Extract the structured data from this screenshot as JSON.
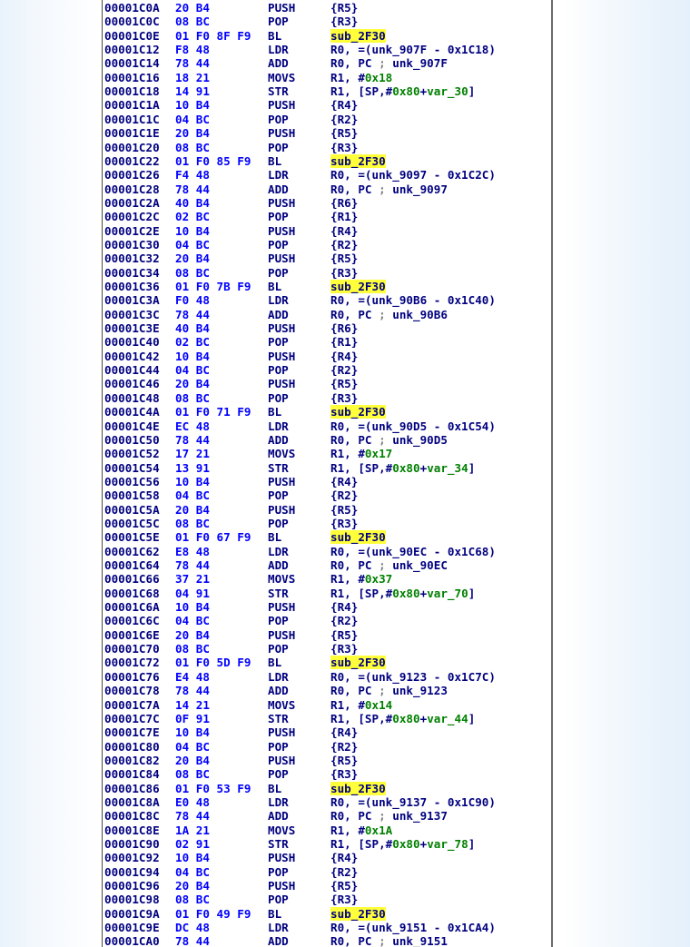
{
  "listing": [
    {
      "addr": "00001C0A",
      "bytes": "20 B4",
      "mnem": "PUSH",
      "ops": [
        {
          "t": "{R5}"
        }
      ]
    },
    {
      "addr": "00001C0C",
      "bytes": "08 BC",
      "mnem": "POP",
      "ops": [
        {
          "t": "{R3}"
        }
      ]
    },
    {
      "addr": "00001C0E",
      "bytes": "01 F0 8F F9",
      "mnem": "BL",
      "ops": [
        {
          "t": "sub_2F30",
          "c": "hl"
        }
      ]
    },
    {
      "addr": "00001C12",
      "bytes": "F8 48",
      "mnem": "LDR",
      "ops": [
        {
          "t": "R0, =(unk_907F - 0x1C18)"
        }
      ]
    },
    {
      "addr": "00001C14",
      "bytes": "78 44",
      "mnem": "ADD",
      "ops": [
        {
          "t": "R0, PC "
        },
        {
          "t": ";",
          "c": "cmt"
        },
        {
          "t": " unk_907F"
        }
      ]
    },
    {
      "addr": "00001C16",
      "bytes": "18 21",
      "mnem": "MOVS",
      "ops": [
        {
          "t": "R1, #"
        },
        {
          "t": "0x18",
          "c": "num"
        }
      ]
    },
    {
      "addr": "00001C18",
      "bytes": "14 91",
      "mnem": "STR",
      "ops": [
        {
          "t": "R1, [SP,#"
        },
        {
          "t": "0x80",
          "c": "num"
        },
        {
          "t": "+"
        },
        {
          "t": "var_30",
          "c": "var"
        },
        {
          "t": "]"
        }
      ]
    },
    {
      "addr": "00001C1A",
      "bytes": "10 B4",
      "mnem": "PUSH",
      "ops": [
        {
          "t": "{R4}"
        }
      ]
    },
    {
      "addr": "00001C1C",
      "bytes": "04 BC",
      "mnem": "POP",
      "ops": [
        {
          "t": "{R2}"
        }
      ]
    },
    {
      "addr": "00001C1E",
      "bytes": "20 B4",
      "mnem": "PUSH",
      "ops": [
        {
          "t": "{R5}"
        }
      ]
    },
    {
      "addr": "00001C20",
      "bytes": "08 BC",
      "mnem": "POP",
      "ops": [
        {
          "t": "{R3}"
        }
      ]
    },
    {
      "addr": "00001C22",
      "bytes": "01 F0 85 F9",
      "mnem": "BL",
      "ops": [
        {
          "t": "sub_2F30",
          "c": "hl"
        }
      ]
    },
    {
      "addr": "00001C26",
      "bytes": "F4 48",
      "mnem": "LDR",
      "ops": [
        {
          "t": "R0, =(unk_9097 - 0x1C2C)"
        }
      ]
    },
    {
      "addr": "00001C28",
      "bytes": "78 44",
      "mnem": "ADD",
      "ops": [
        {
          "t": "R0, PC "
        },
        {
          "t": ";",
          "c": "cmt"
        },
        {
          "t": " unk_9097"
        }
      ]
    },
    {
      "addr": "00001C2A",
      "bytes": "40 B4",
      "mnem": "PUSH",
      "ops": [
        {
          "t": "{R6}"
        }
      ]
    },
    {
      "addr": "00001C2C",
      "bytes": "02 BC",
      "mnem": "POP",
      "ops": [
        {
          "t": "{R1}"
        }
      ]
    },
    {
      "addr": "00001C2E",
      "bytes": "10 B4",
      "mnem": "PUSH",
      "ops": [
        {
          "t": "{R4}"
        }
      ]
    },
    {
      "addr": "00001C30",
      "bytes": "04 BC",
      "mnem": "POP",
      "ops": [
        {
          "t": "{R2}"
        }
      ]
    },
    {
      "addr": "00001C32",
      "bytes": "20 B4",
      "mnem": "PUSH",
      "ops": [
        {
          "t": "{R5}"
        }
      ]
    },
    {
      "addr": "00001C34",
      "bytes": "08 BC",
      "mnem": "POP",
      "ops": [
        {
          "t": "{R3}"
        }
      ]
    },
    {
      "addr": "00001C36",
      "bytes": "01 F0 7B F9",
      "mnem": "BL",
      "ops": [
        {
          "t": "sub_2F30",
          "c": "hl"
        }
      ]
    },
    {
      "addr": "00001C3A",
      "bytes": "F0 48",
      "mnem": "LDR",
      "ops": [
        {
          "t": "R0, =(unk_90B6 - 0x1C40)"
        }
      ]
    },
    {
      "addr": "00001C3C",
      "bytes": "78 44",
      "mnem": "ADD",
      "ops": [
        {
          "t": "R0, PC "
        },
        {
          "t": ";",
          "c": "cmt"
        },
        {
          "t": " unk_90B6"
        }
      ]
    },
    {
      "addr": "00001C3E",
      "bytes": "40 B4",
      "mnem": "PUSH",
      "ops": [
        {
          "t": "{R6}"
        }
      ]
    },
    {
      "addr": "00001C40",
      "bytes": "02 BC",
      "mnem": "POP",
      "ops": [
        {
          "t": "{R1}"
        }
      ]
    },
    {
      "addr": "00001C42",
      "bytes": "10 B4",
      "mnem": "PUSH",
      "ops": [
        {
          "t": "{R4}"
        }
      ]
    },
    {
      "addr": "00001C44",
      "bytes": "04 BC",
      "mnem": "POP",
      "ops": [
        {
          "t": "{R2}"
        }
      ]
    },
    {
      "addr": "00001C46",
      "bytes": "20 B4",
      "mnem": "PUSH",
      "ops": [
        {
          "t": "{R5}"
        }
      ]
    },
    {
      "addr": "00001C48",
      "bytes": "08 BC",
      "mnem": "POP",
      "ops": [
        {
          "t": "{R3}"
        }
      ]
    },
    {
      "addr": "00001C4A",
      "bytes": "01 F0 71 F9",
      "mnem": "BL",
      "ops": [
        {
          "t": "sub_2F30",
          "c": "hl"
        }
      ]
    },
    {
      "addr": "00001C4E",
      "bytes": "EC 48",
      "mnem": "LDR",
      "ops": [
        {
          "t": "R0, =(unk_90D5 - 0x1C54)"
        }
      ]
    },
    {
      "addr": "00001C50",
      "bytes": "78 44",
      "mnem": "ADD",
      "ops": [
        {
          "t": "R0, PC "
        },
        {
          "t": ";",
          "c": "cmt"
        },
        {
          "t": " unk_90D5"
        }
      ]
    },
    {
      "addr": "00001C52",
      "bytes": "17 21",
      "mnem": "MOVS",
      "ops": [
        {
          "t": "R1, #"
        },
        {
          "t": "0x17",
          "c": "num"
        }
      ]
    },
    {
      "addr": "00001C54",
      "bytes": "13 91",
      "mnem": "STR",
      "ops": [
        {
          "t": "R1, [SP,#"
        },
        {
          "t": "0x80",
          "c": "num"
        },
        {
          "t": "+"
        },
        {
          "t": "var_34",
          "c": "var"
        },
        {
          "t": "]"
        }
      ]
    },
    {
      "addr": "00001C56",
      "bytes": "10 B4",
      "mnem": "PUSH",
      "ops": [
        {
          "t": "{R4}"
        }
      ]
    },
    {
      "addr": "00001C58",
      "bytes": "04 BC",
      "mnem": "POP",
      "ops": [
        {
          "t": "{R2}"
        }
      ]
    },
    {
      "addr": "00001C5A",
      "bytes": "20 B4",
      "mnem": "PUSH",
      "ops": [
        {
          "t": "{R5}"
        }
      ]
    },
    {
      "addr": "00001C5C",
      "bytes": "08 BC",
      "mnem": "POP",
      "ops": [
        {
          "t": "{R3}"
        }
      ]
    },
    {
      "addr": "00001C5E",
      "bytes": "01 F0 67 F9",
      "mnem": "BL",
      "ops": [
        {
          "t": "sub_2F30",
          "c": "hl"
        }
      ]
    },
    {
      "addr": "00001C62",
      "bytes": "E8 48",
      "mnem": "LDR",
      "ops": [
        {
          "t": "R0, =(unk_90EC - 0x1C68)"
        }
      ]
    },
    {
      "addr": "00001C64",
      "bytes": "78 44",
      "mnem": "ADD",
      "ops": [
        {
          "t": "R0, PC "
        },
        {
          "t": ";",
          "c": "cmt"
        },
        {
          "t": " unk_90EC"
        }
      ]
    },
    {
      "addr": "00001C66",
      "bytes": "37 21",
      "mnem": "MOVS",
      "ops": [
        {
          "t": "R1, #"
        },
        {
          "t": "0x37",
          "c": "num"
        }
      ]
    },
    {
      "addr": "00001C68",
      "bytes": "04 91",
      "mnem": "STR",
      "ops": [
        {
          "t": "R1, [SP,#"
        },
        {
          "t": "0x80",
          "c": "num"
        },
        {
          "t": "+"
        },
        {
          "t": "var_70",
          "c": "var"
        },
        {
          "t": "]"
        }
      ]
    },
    {
      "addr": "00001C6A",
      "bytes": "10 B4",
      "mnem": "PUSH",
      "ops": [
        {
          "t": "{R4}"
        }
      ]
    },
    {
      "addr": "00001C6C",
      "bytes": "04 BC",
      "mnem": "POP",
      "ops": [
        {
          "t": "{R2}"
        }
      ]
    },
    {
      "addr": "00001C6E",
      "bytes": "20 B4",
      "mnem": "PUSH",
      "ops": [
        {
          "t": "{R5}"
        }
      ]
    },
    {
      "addr": "00001C70",
      "bytes": "08 BC",
      "mnem": "POP",
      "ops": [
        {
          "t": "{R3}"
        }
      ]
    },
    {
      "addr": "00001C72",
      "bytes": "01 F0 5D F9",
      "mnem": "BL",
      "ops": [
        {
          "t": "sub_2F30",
          "c": "hl"
        }
      ]
    },
    {
      "addr": "00001C76",
      "bytes": "E4 48",
      "mnem": "LDR",
      "ops": [
        {
          "t": "R0, =(unk_9123 - 0x1C7C)"
        }
      ]
    },
    {
      "addr": "00001C78",
      "bytes": "78 44",
      "mnem": "ADD",
      "ops": [
        {
          "t": "R0, PC "
        },
        {
          "t": ";",
          "c": "cmt"
        },
        {
          "t": " unk_9123"
        }
      ]
    },
    {
      "addr": "00001C7A",
      "bytes": "14 21",
      "mnem": "MOVS",
      "ops": [
        {
          "t": "R1, #"
        },
        {
          "t": "0x14",
          "c": "num"
        }
      ]
    },
    {
      "addr": "00001C7C",
      "bytes": "0F 91",
      "mnem": "STR",
      "ops": [
        {
          "t": "R1, [SP,#"
        },
        {
          "t": "0x80",
          "c": "num"
        },
        {
          "t": "+"
        },
        {
          "t": "var_44",
          "c": "var"
        },
        {
          "t": "]"
        }
      ]
    },
    {
      "addr": "00001C7E",
      "bytes": "10 B4",
      "mnem": "PUSH",
      "ops": [
        {
          "t": "{R4}"
        }
      ]
    },
    {
      "addr": "00001C80",
      "bytes": "04 BC",
      "mnem": "POP",
      "ops": [
        {
          "t": "{R2}"
        }
      ]
    },
    {
      "addr": "00001C82",
      "bytes": "20 B4",
      "mnem": "PUSH",
      "ops": [
        {
          "t": "{R5}"
        }
      ]
    },
    {
      "addr": "00001C84",
      "bytes": "08 BC",
      "mnem": "POP",
      "ops": [
        {
          "t": "{R3}"
        }
      ]
    },
    {
      "addr": "00001C86",
      "bytes": "01 F0 53 F9",
      "mnem": "BL",
      "ops": [
        {
          "t": "sub_2F30",
          "c": "hl"
        }
      ]
    },
    {
      "addr": "00001C8A",
      "bytes": "E0 48",
      "mnem": "LDR",
      "ops": [
        {
          "t": "R0, =(unk_9137 - 0x1C90)"
        }
      ]
    },
    {
      "addr": "00001C8C",
      "bytes": "78 44",
      "mnem": "ADD",
      "ops": [
        {
          "t": "R0, PC "
        },
        {
          "t": ";",
          "c": "cmt"
        },
        {
          "t": " unk_9137"
        }
      ]
    },
    {
      "addr": "00001C8E",
      "bytes": "1A 21",
      "mnem": "MOVS",
      "ops": [
        {
          "t": "R1, #"
        },
        {
          "t": "0x1A",
          "c": "num"
        }
      ]
    },
    {
      "addr": "00001C90",
      "bytes": "02 91",
      "mnem": "STR",
      "ops": [
        {
          "t": "R1, [SP,#"
        },
        {
          "t": "0x80",
          "c": "num"
        },
        {
          "t": "+"
        },
        {
          "t": "var_78",
          "c": "var"
        },
        {
          "t": "]"
        }
      ]
    },
    {
      "addr": "00001C92",
      "bytes": "10 B4",
      "mnem": "PUSH",
      "ops": [
        {
          "t": "{R4}"
        }
      ]
    },
    {
      "addr": "00001C94",
      "bytes": "04 BC",
      "mnem": "POP",
      "ops": [
        {
          "t": "{R2}"
        }
      ]
    },
    {
      "addr": "00001C96",
      "bytes": "20 B4",
      "mnem": "PUSH",
      "ops": [
        {
          "t": "{R5}"
        }
      ]
    },
    {
      "addr": "00001C98",
      "bytes": "08 BC",
      "mnem": "POP",
      "ops": [
        {
          "t": "{R3}"
        }
      ]
    },
    {
      "addr": "00001C9A",
      "bytes": "01 F0 49 F9",
      "mnem": "BL",
      "ops": [
        {
          "t": "sub_2F30",
          "c": "hl"
        }
      ]
    },
    {
      "addr": "00001C9E",
      "bytes": "DC 48",
      "mnem": "LDR",
      "ops": [
        {
          "t": "R0, =(unk_9151 - 0x1CA4)"
        }
      ]
    },
    {
      "addr": "00001CA0",
      "bytes": "78 44",
      "mnem": "ADD",
      "ops": [
        {
          "t": "R0, PC "
        },
        {
          "t": ";",
          "c": "cmt"
        },
        {
          "t": " unk_9151"
        }
      ]
    }
  ],
  "colors": {
    "text": "#000080",
    "bytes": "#0000ff",
    "highlight": "#ffff3a",
    "numeric": "#008000",
    "comment": "#808080"
  }
}
